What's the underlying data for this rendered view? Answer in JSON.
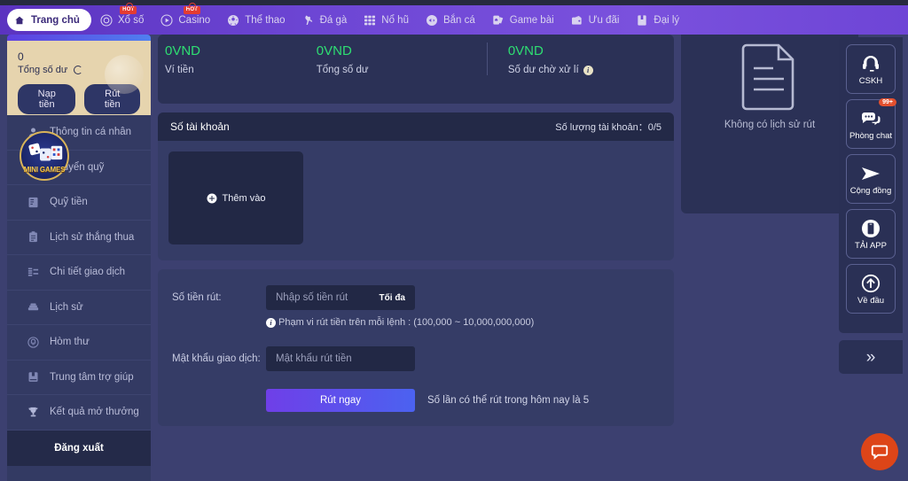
{
  "topnav": {
    "items": [
      {
        "label": "Trang chủ",
        "icon": "home-icon",
        "active": true,
        "hot": null
      },
      {
        "label": "Xổ số",
        "icon": "lottery-icon",
        "active": false,
        "hot": "HOT"
      },
      {
        "label": "Casino",
        "icon": "casino-play-icon",
        "active": false,
        "hot": "HOT"
      },
      {
        "label": "Thể thao",
        "icon": "soccer-ball-icon",
        "active": false,
        "hot": null
      },
      {
        "label": "Đá gà",
        "icon": "rooster-icon",
        "active": false,
        "hot": null
      },
      {
        "label": "Nổ hũ",
        "icon": "slots-grid-icon",
        "active": false,
        "hot": null
      },
      {
        "label": "Bắn cá",
        "icon": "fish-shooting-icon",
        "active": false,
        "hot": null
      },
      {
        "label": "Game bài",
        "icon": "card-game-icon",
        "active": false,
        "hot": null
      },
      {
        "label": "Ưu đãi",
        "icon": "gift-wallet-icon",
        "active": false,
        "hot": null
      },
      {
        "label": "Đại lý",
        "icon": "agency-book-icon",
        "active": false,
        "hot": null
      }
    ]
  },
  "sidebar": {
    "user": {
      "balance_amount": "0",
      "balance_label": "Tổng số dư",
      "deposit_button": "Nạp tiền",
      "withdraw_button": "Rút tiền"
    },
    "mini_games_badge": "MINI GAMES",
    "items": [
      {
        "label": "Thông tin cá nhân",
        "icon": "user-profile-icon"
      },
      {
        "label": "Chuyển quỹ",
        "icon": "transfer-funds-icon"
      },
      {
        "label": "Quỹ tiền",
        "icon": "money-fund-icon"
      },
      {
        "label": "Lịch sử thắng thua",
        "icon": "win-loss-history-icon"
      },
      {
        "label": "Chi tiết giao dịch",
        "icon": "transaction-detail-icon"
      },
      {
        "label": "Lịch sử",
        "icon": "history-icon"
      },
      {
        "label": "Hòm thư",
        "icon": "mailbox-icon"
      },
      {
        "label": "Trung tâm trợ giúp",
        "icon": "help-center-icon"
      },
      {
        "label": "Kết quả mở thưởng",
        "icon": "trophy-icon"
      }
    ],
    "logout": "Đăng xuất"
  },
  "balance_cards": [
    {
      "value": "0VND",
      "label": "Ví tiền",
      "info": false
    },
    {
      "value": "0VND",
      "label": "Tổng số dư",
      "info": false
    },
    {
      "value": "0VND",
      "label": "Số dư chờ xử lí",
      "info": true
    }
  ],
  "accounts": {
    "title": "Số tài khoản",
    "count_label": "Số lượng tài khoản：",
    "count_value": "0/5",
    "add_label": "Thêm vào"
  },
  "withdraw_form": {
    "amount_label": "Số tiền rút:",
    "amount_placeholder": "Nhập số tiền rút",
    "max_label": "Tối đa",
    "hint": "Phạm vi rút tiền trên mỗi lệnh : (100,000 ~ 10,000,000,000)",
    "password_label": "Mật khẩu giao dịch:",
    "password_placeholder": "Mật khẩu rút tiền",
    "submit_label": "Rút ngay",
    "submit_note": "Số lần có thể rút trong hôm nay là 5"
  },
  "history_panel": {
    "empty_text": "Không có lịch sử rút",
    "empty_icon": "document-icon"
  },
  "rail": {
    "items": [
      {
        "label": "CSKH",
        "icon": "headset-icon",
        "badge": null
      },
      {
        "label": "Phòng chat",
        "icon": "chat-bubbles-icon",
        "badge": "99+"
      },
      {
        "label": "Cộng đồng",
        "icon": "telegram-send-icon",
        "badge": null
      },
      {
        "label": "TẢI APP",
        "icon": "mobile-app-icon",
        "badge": null
      },
      {
        "label": "Về đầu",
        "icon": "arrow-up-circle-icon",
        "badge": null
      }
    ],
    "toggle_icon": "double-chevron-right-icon",
    "chat_fab_icon": "chat-fab-icon"
  },
  "colors": {
    "page_bg": "#3c4070",
    "nav_purple": "#6d46d4",
    "panel": "#2b3156",
    "panel_alt": "#353c66",
    "input_bg": "#222845",
    "green_value": "#2ede72",
    "accent_button": "#5b4ded",
    "hot_red": "#e33c32",
    "fab_orange": "#dd4518",
    "gold": "#d9b45a",
    "user_card_bg": "#e6d4ae"
  }
}
